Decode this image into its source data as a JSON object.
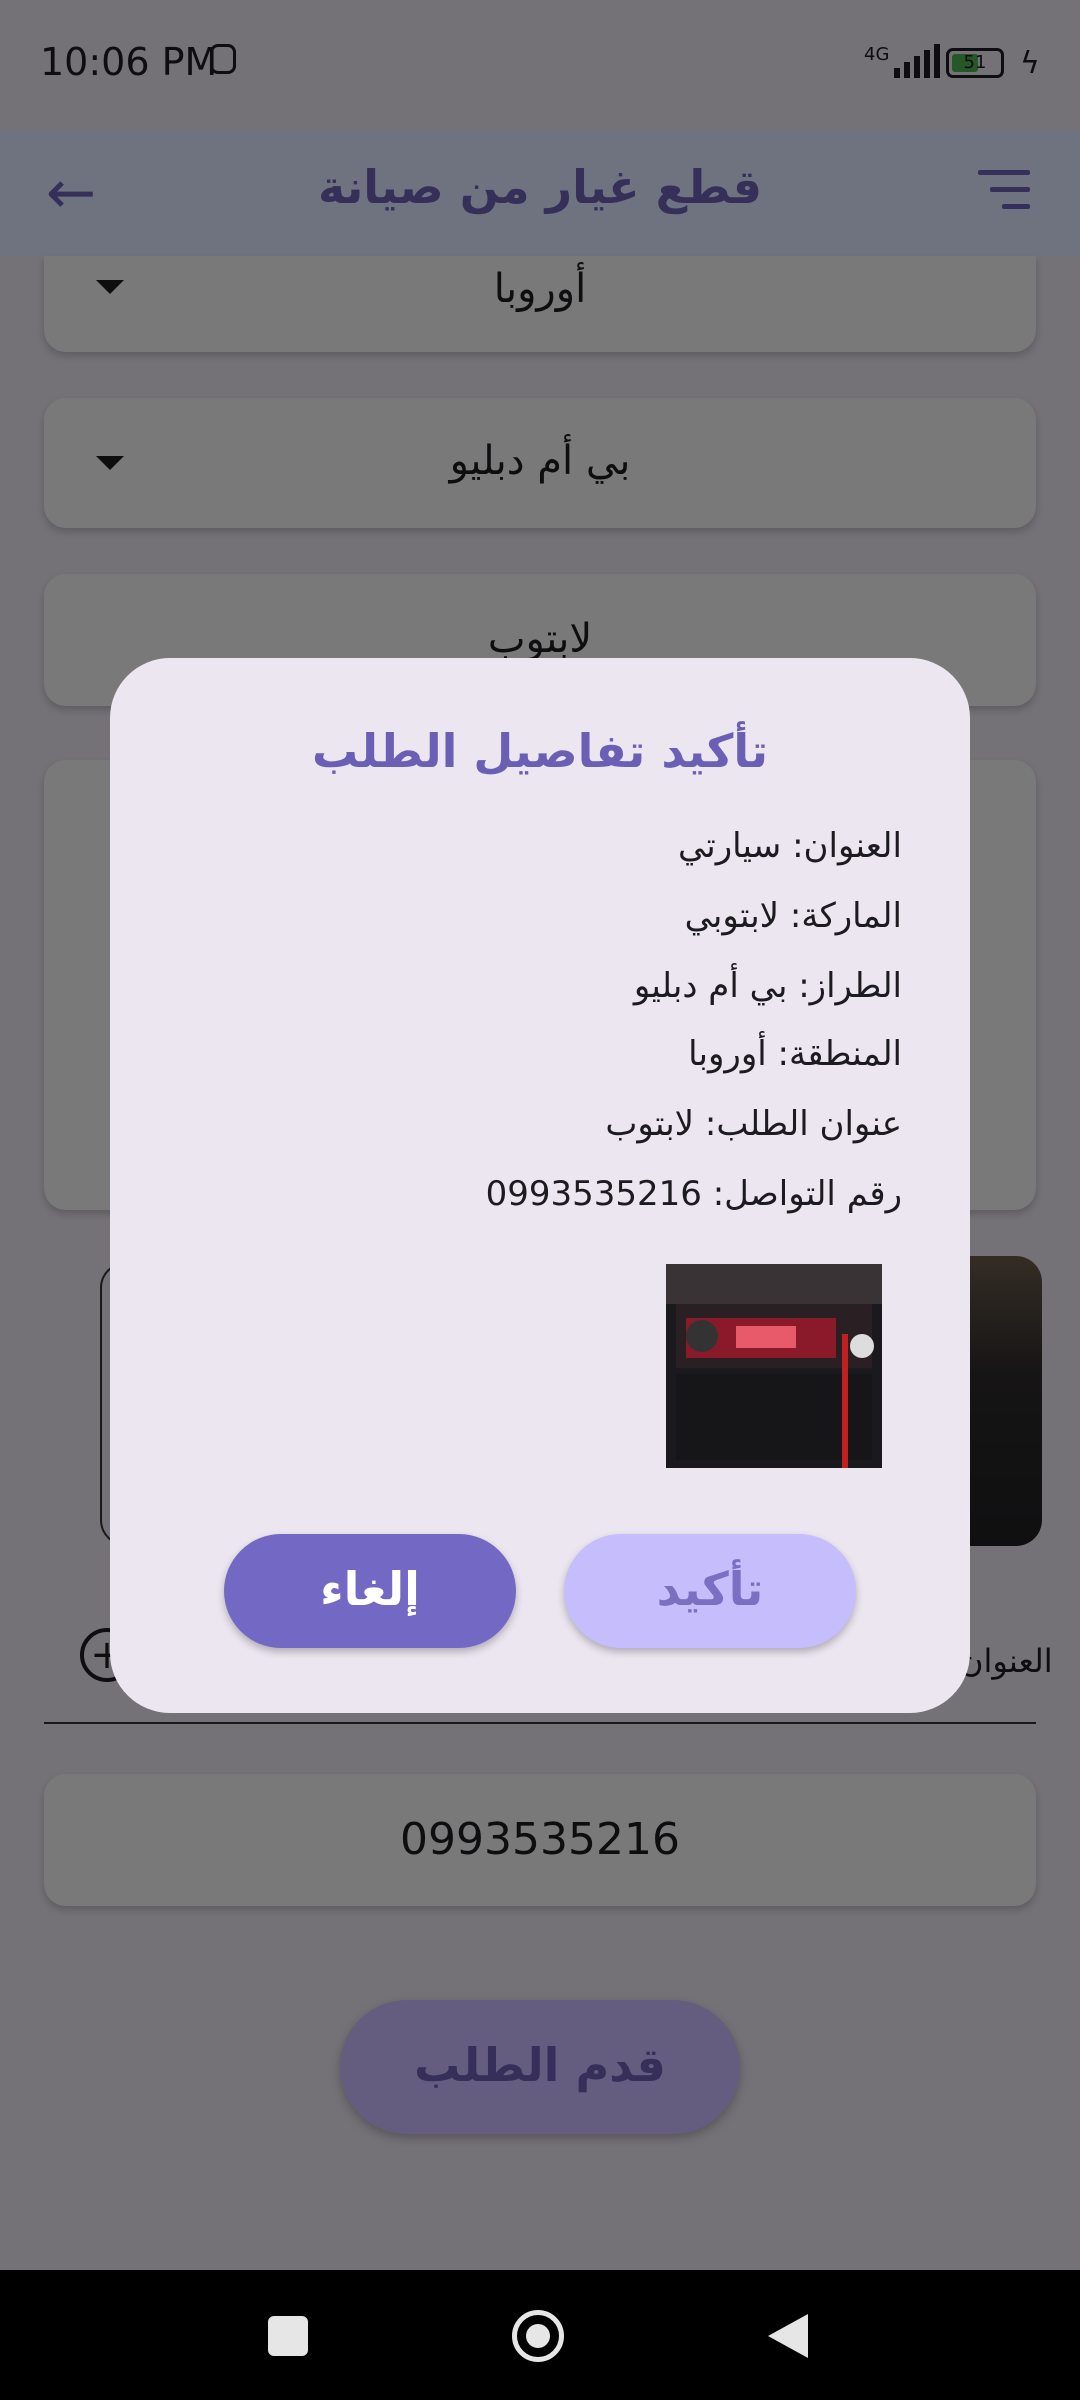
{
  "status_bar": {
    "time": "10:06 PM",
    "network": "4G",
    "battery": "51"
  },
  "app_bar": {
    "title": "قطع غيار من صيانة",
    "back_icon": "arrow-back-icon",
    "menu_icon": "sort-menu-icon"
  },
  "form": {
    "region_value": "أوروبا",
    "model_value": "بي أم دبليو",
    "request_title_value": "لابتوب",
    "address_label": "العنوان",
    "phone_value": "0993535216",
    "submit_label": "قدم الطلب"
  },
  "dialog": {
    "title": "تأكيد تفاصيل الطلب",
    "details": [
      "العنوان: سيارتي",
      "الماركة: لابتوبي",
      "الطراز: بي أم دبليو",
      "المنطقة: أوروبا",
      "عنوان الطلب: لابتوب",
      "رقم التواصل: 0993535216"
    ],
    "confirm_label": "تأكيد",
    "cancel_label": "إلغاء"
  },
  "colors": {
    "primary": "#6a5fb5",
    "primary_container": "#c8bbff",
    "surface": "#ece6f0",
    "app_bar": "#dfe5ff"
  }
}
